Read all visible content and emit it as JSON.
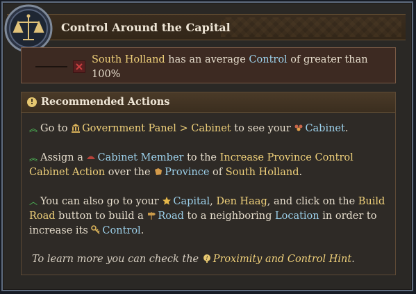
{
  "header": {
    "title": "Control Around the Capital"
  },
  "condition": {
    "parts": [
      "South Holland",
      " has an average ",
      "Control",
      " of greater than 100%"
    ]
  },
  "recommended": {
    "title": "Recommended Actions",
    "p1": [
      "Go to ",
      "Government Panel > Cabinet",
      " to see your ",
      "Cabinet",
      "."
    ],
    "p2": [
      "Assign a ",
      "Cabinet Member",
      " to the ",
      "Increase Province Control Cabinet Action",
      " over the ",
      "Province",
      " of ",
      "South Holland",
      "."
    ],
    "p3": [
      "You can also go to your ",
      "Capital",
      ", ",
      "Den Haag",
      ", and click on the ",
      "Build Road",
      " button to build a ",
      "Road",
      " to a neighboring ",
      "Location",
      " in order to increase its ",
      "Control",
      "."
    ],
    "p4": [
      "To learn more you can check the ",
      "Proximity and Control Hint",
      "."
    ]
  },
  "colors": {
    "highlight_yellow": "#efd07a",
    "highlight_blue": "#9cd0ea",
    "text": "#e5dccb"
  },
  "icons": [
    "scales-emblem-icon",
    "red-x-icon",
    "info-icon",
    "rank-chevron-icon",
    "government-building-icon",
    "cabinet-icon",
    "cabinet-member-icon",
    "province-icon",
    "capital-star-icon",
    "road-sign-icon",
    "control-key-icon",
    "hint-icon"
  ]
}
